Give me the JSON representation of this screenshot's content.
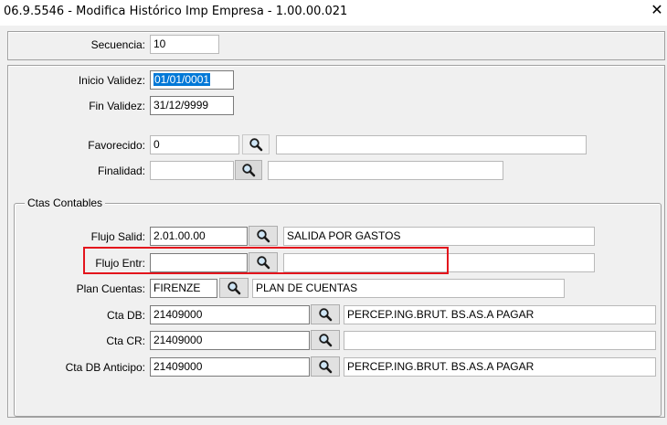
{
  "window": {
    "title": "06.9.5546 - Modifica Histórico Imp Empresa - 1.00.00.021"
  },
  "form": {
    "secuencia": {
      "label": "Secuencia:",
      "value": "10"
    },
    "inicio_validez": {
      "label": "Inicio Validez:",
      "value": "01/01/0001"
    },
    "fin_validez": {
      "label": "Fin Validez:",
      "value": "31/12/9999"
    },
    "favorecido": {
      "label": "Favorecido:",
      "value": "0",
      "description": ""
    },
    "finalidad": {
      "label": "Finalidad:",
      "value": "",
      "description": ""
    }
  },
  "ctas_contables": {
    "legend": "Ctas Contables",
    "flujo_salid": {
      "label": "Flujo Salid:",
      "value": "2.01.00.00",
      "description": "SALIDA POR GASTOS"
    },
    "flujo_entr": {
      "label": "Flujo Entr:",
      "value": "",
      "description": ""
    },
    "plan_cuentas": {
      "label": "Plan Cuentas:",
      "value": "FIRENZE",
      "description": "PLAN DE CUENTAS"
    },
    "cta_db": {
      "label": "Cta DB:",
      "value": "21409000",
      "description": "PERCEP.ING.BRUT. BS.AS.A PAGAR"
    },
    "cta_cr": {
      "label": "Cta CR:",
      "value": "21409000",
      "description": ""
    },
    "cta_db_anticipo": {
      "label": "Cta DB Anticipo:",
      "value": "21409000",
      "description": "PERCEP.ING.BRUT. BS.AS.A PAGAR"
    }
  },
  "icons": {
    "search": "search-icon",
    "close": "close-icon"
  }
}
